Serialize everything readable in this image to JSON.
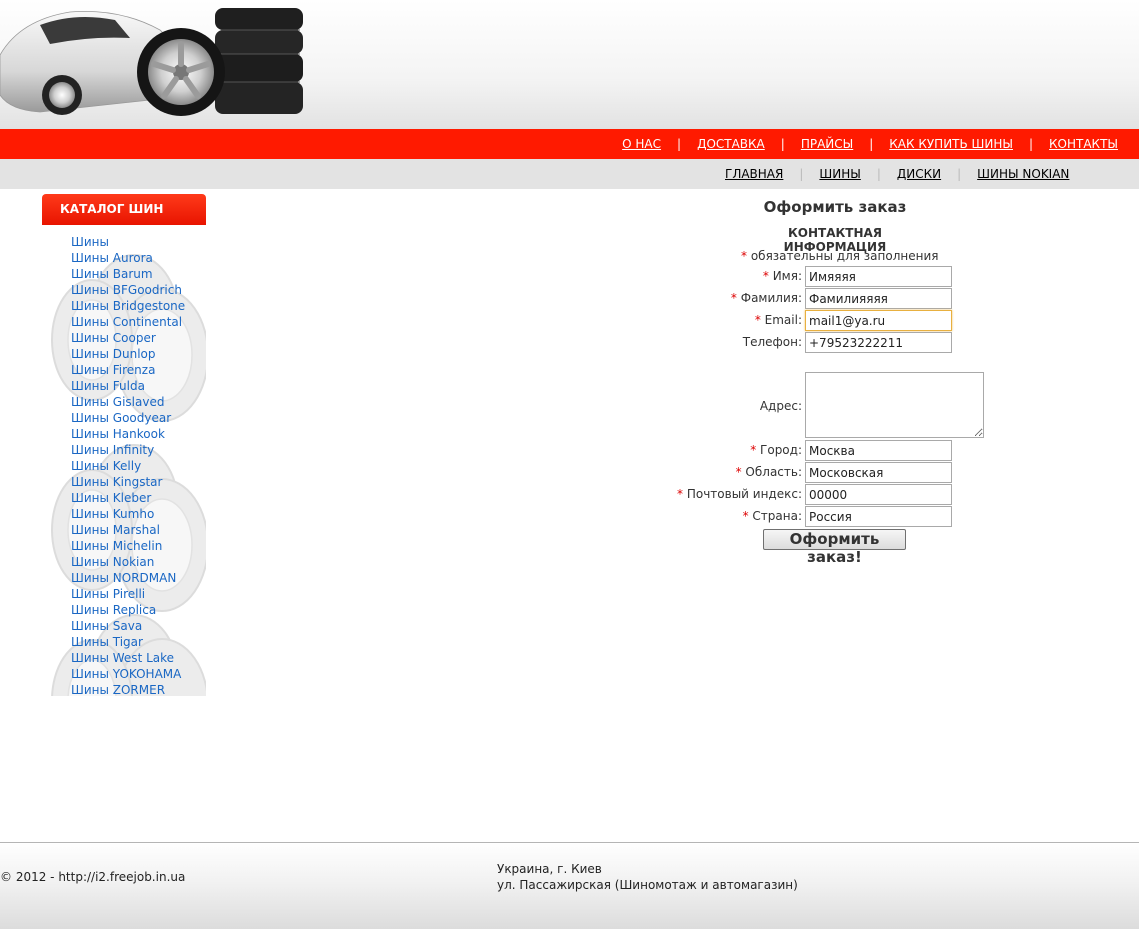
{
  "top_nav": [
    {
      "label": "О НАС"
    },
    {
      "label": "ДОСТАВКА"
    },
    {
      "label": "ПРАЙСЫ"
    },
    {
      "label": "КАК КУПИТЬ ШИНЫ"
    },
    {
      "label": "КОНТАКТЫ"
    }
  ],
  "top_nav_separator": "|",
  "sub_nav": [
    {
      "label": "ГЛАВНАЯ"
    },
    {
      "label": "ШИНЫ"
    },
    {
      "label": "ДИСКИ"
    },
    {
      "label": "ШИНЫ NOKIAN"
    }
  ],
  "sub_nav_separator": "|",
  "sidebar": {
    "title": "КАТАЛОГ ШИН",
    "items": [
      "Шины",
      "Шины Aurora",
      "Шины Barum",
      "Шины BFGoodrich",
      "Шины Bridgestone",
      "Шины Continental",
      "Шины Cooper",
      "Шины Dunlop",
      "Шины Firenza",
      "Шины Fulda",
      "Шины Gislaved",
      "Шины Goodyear",
      "Шины Hankook",
      "Шины Infinity",
      "Шины Kelly",
      "Шины Kingstar",
      "Шины Kleber",
      "Шины Kumho",
      "Шины Marshal",
      "Шины Michelin",
      "Шины Nokian",
      "Шины NORDMAN",
      "Шины Pirelli",
      "Шины Replica",
      "Шины Sava",
      "Шины Tigar",
      "Шины West Lake",
      "Шины YOKOHAMA",
      "Шины ZORMER"
    ]
  },
  "form": {
    "title": "Оформить заказ",
    "section": "КОНТАКТНАЯ ИНФОРМАЦИЯ",
    "required_mark": "*",
    "required_note": "обязательны для заполнения",
    "first_name": {
      "label": "Имя:",
      "value": "Имяяяя"
    },
    "last_name": {
      "label": "Фамилия:",
      "value": "Фамилияяяя"
    },
    "email": {
      "label": "Email:",
      "value": "mail1@ya.ru"
    },
    "phone": {
      "label": "Телефон:",
      "value": "+79523222211"
    },
    "address": {
      "label": "Адрес:",
      "value": ""
    },
    "city": {
      "label": "Город:",
      "value": "Москва"
    },
    "region": {
      "label": "Область:",
      "value": "Московская"
    },
    "zip": {
      "label": "Почтовый индекс:",
      "value": "00000"
    },
    "country": {
      "label": "Страна:",
      "value": "Россия"
    },
    "submit_label": "Оформить заказ!"
  },
  "footer": {
    "copyright": "© 2012 - http://i2.freejob.in.ua",
    "address_line1": "Украина, г. Киев",
    "address_line2": "ул. Пассажирская (Шиномотаж и автомагазин)"
  },
  "colors": {
    "nav_red": "#ff1a00",
    "link_blue": "#1a67c4",
    "required_red": "#dd0000"
  }
}
